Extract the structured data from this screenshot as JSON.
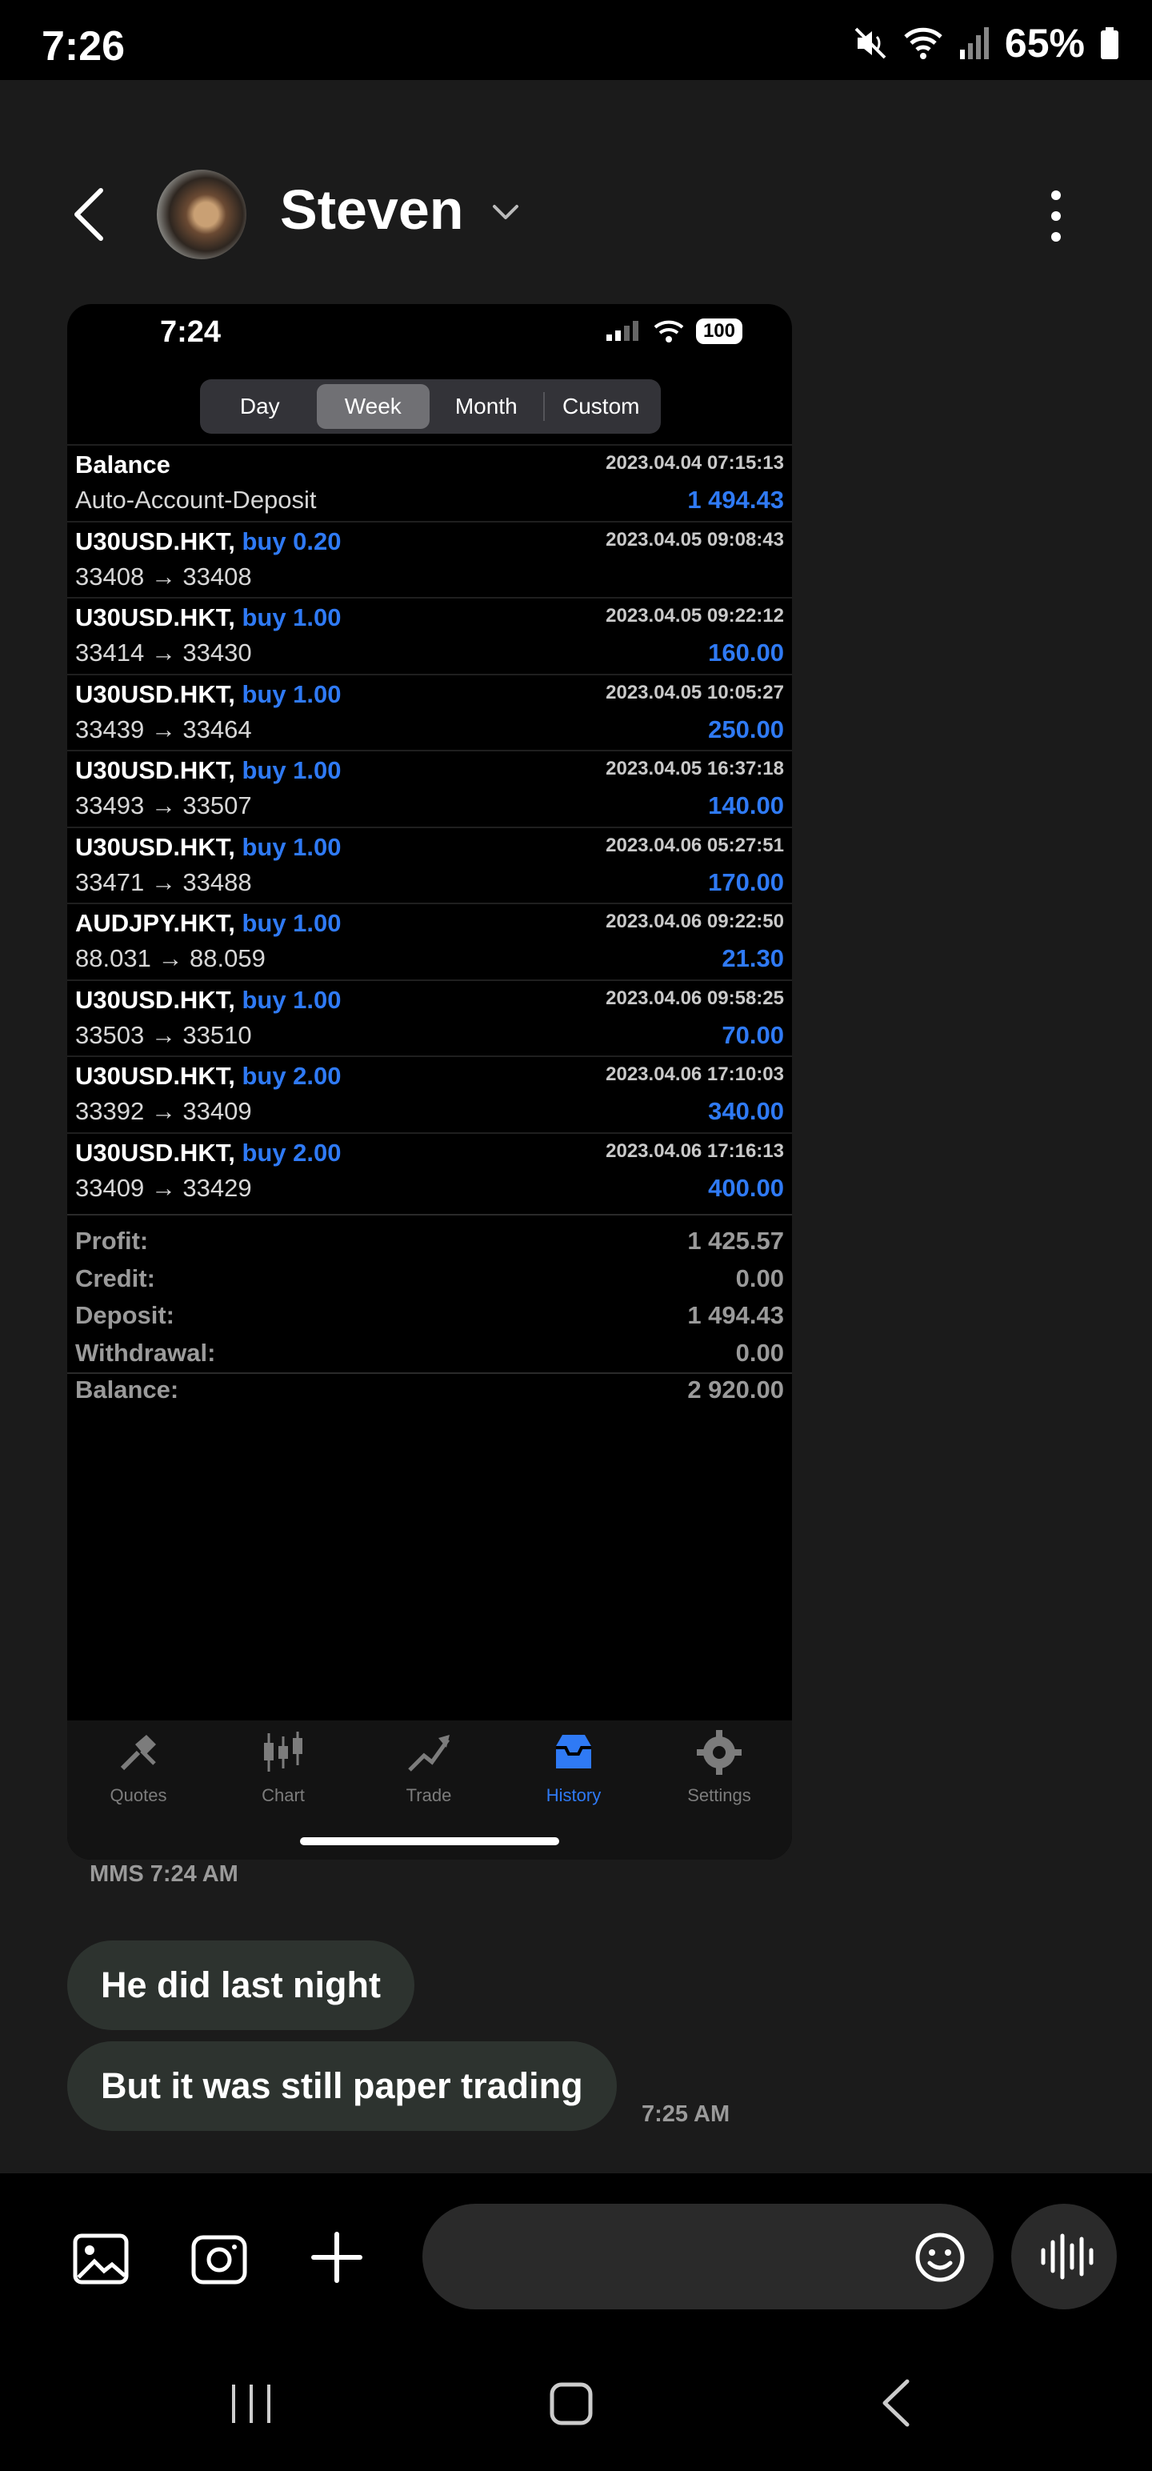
{
  "android_status": {
    "time": "7:26",
    "battery": "65%"
  },
  "conversation": {
    "contact_name": "Steven"
  },
  "mms": {
    "ios_status": {
      "time": "7:24",
      "battery": "100"
    },
    "period_tabs": [
      "Day",
      "Week",
      "Month",
      "Custom"
    ],
    "active_tab": "Week",
    "rows": [
      {
        "symbol": "Balance",
        "side": "",
        "date": "2023.04.04 07:15:13",
        "prices": "Auto-Account-Deposit",
        "amount": "1 494.43"
      },
      {
        "symbol": "U30USD.HKT,",
        "side": "buy 0.20",
        "date": "2023.04.05 09:08:43",
        "prices": "33408 → 33408",
        "amount": ""
      },
      {
        "symbol": "U30USD.HKT,",
        "side": "buy 1.00",
        "date": "2023.04.05 09:22:12",
        "prices": "33414 → 33430",
        "amount": "160.00"
      },
      {
        "symbol": "U30USD.HKT,",
        "side": "buy 1.00",
        "date": "2023.04.05 10:05:27",
        "prices": "33439 → 33464",
        "amount": "250.00"
      },
      {
        "symbol": "U30USD.HKT,",
        "side": "buy 1.00",
        "date": "2023.04.05 16:37:18",
        "prices": "33493 → 33507",
        "amount": "140.00"
      },
      {
        "symbol": "U30USD.HKT,",
        "side": "buy 1.00",
        "date": "2023.04.06 05:27:51",
        "prices": "33471 → 33488",
        "amount": "170.00"
      },
      {
        "symbol": "AUDJPY.HKT,",
        "side": "buy 1.00",
        "date": "2023.04.06 09:22:50",
        "prices": "88.031 → 88.059",
        "amount": "21.30"
      },
      {
        "symbol": "U30USD.HKT,",
        "side": "buy 1.00",
        "date": "2023.04.06 09:58:25",
        "prices": "33503 → 33510",
        "amount": "70.00"
      },
      {
        "symbol": "U30USD.HKT,",
        "side": "buy 2.00",
        "date": "2023.04.06 17:10:03",
        "prices": "33392 → 33409",
        "amount": "340.00"
      },
      {
        "symbol": "U30USD.HKT,",
        "side": "buy 2.00",
        "date": "2023.04.06 17:16:13",
        "prices": "33409 → 33429",
        "amount": "400.00"
      }
    ],
    "summary": [
      {
        "label": "Profit:",
        "value": "1 425.57"
      },
      {
        "label": "Credit:",
        "value": "0.00"
      },
      {
        "label": "Deposit:",
        "value": "1 494.43"
      },
      {
        "label": "Withdrawal:",
        "value": "0.00"
      },
      {
        "label": "Balance:",
        "value": "2 920.00"
      }
    ],
    "tabbar": [
      {
        "label": "Quotes",
        "icon": "quotes-icon"
      },
      {
        "label": "Chart",
        "icon": "chart-icon"
      },
      {
        "label": "Trade",
        "icon": "trade-icon"
      },
      {
        "label": "History",
        "icon": "history-icon"
      },
      {
        "label": "Settings",
        "icon": "settings-icon"
      }
    ],
    "active_tabbar": "History",
    "meta": "MMS 7:24 AM"
  },
  "messages": [
    {
      "text": "He did last night"
    },
    {
      "text": "But it was still paper trading",
      "time": "7:25 AM"
    }
  ],
  "compose": {
    "placeholder": ""
  },
  "colors": {
    "accent_blue": "#2f7af5",
    "bubble_bg": "#2d332f",
    "background": "#1b1b1b"
  }
}
